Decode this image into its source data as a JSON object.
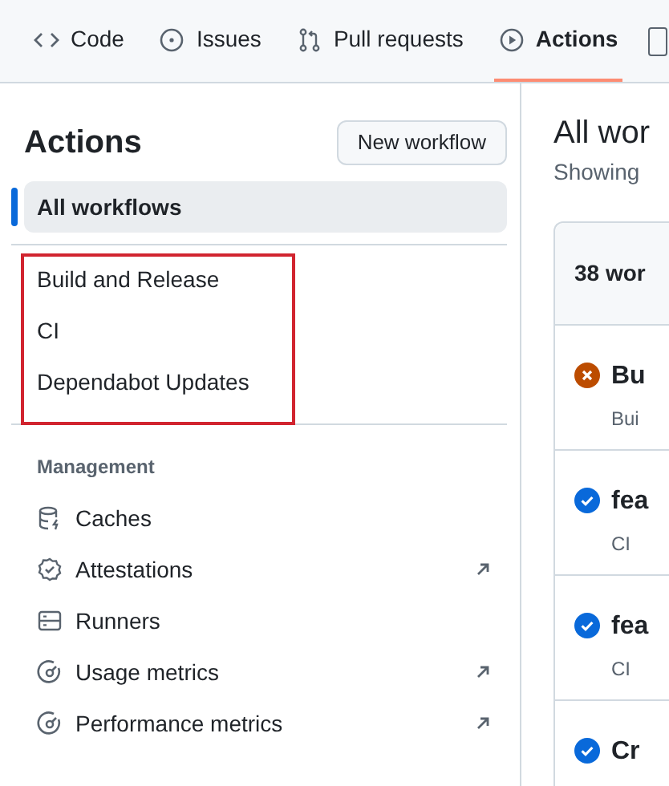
{
  "tabs": [
    {
      "label": "Code",
      "kind": "code",
      "selected": false
    },
    {
      "label": "Issues",
      "kind": "issue",
      "selected": false
    },
    {
      "label": "Pull requests",
      "kind": "pr",
      "selected": false
    },
    {
      "label": "Actions",
      "kind": "play",
      "selected": true
    }
  ],
  "sidebar": {
    "title": "Actions",
    "new_button": "New workflow",
    "all_workflows": {
      "label": "All workflows",
      "selected": true
    },
    "workflows": [
      {
        "label": "Build and Release",
        "selected": false
      },
      {
        "label": "CI",
        "selected": false
      },
      {
        "label": "Dependabot Updates",
        "selected": false
      }
    ],
    "section_heading": "Management",
    "management": [
      {
        "label": "Caches",
        "kind": "database",
        "external": false
      },
      {
        "label": "Attestations",
        "kind": "verified",
        "external": true
      },
      {
        "label": "Runners",
        "kind": "server",
        "external": false
      },
      {
        "label": "Usage metrics",
        "kind": "meter",
        "external": true
      },
      {
        "label": "Performance metrics",
        "kind": "meter",
        "external": true
      }
    ]
  },
  "main": {
    "title": "All wor",
    "subtitle": "Showing",
    "count": "38 wor",
    "runs": [
      {
        "title": "Bu",
        "meta": "Bui",
        "kind": "failure"
      },
      {
        "title": "fea",
        "meta": "CI",
        "kind": "success"
      },
      {
        "title": "fea",
        "meta": "CI",
        "kind": "success"
      },
      {
        "title": "Cr",
        "kind": "success"
      }
    ]
  }
}
